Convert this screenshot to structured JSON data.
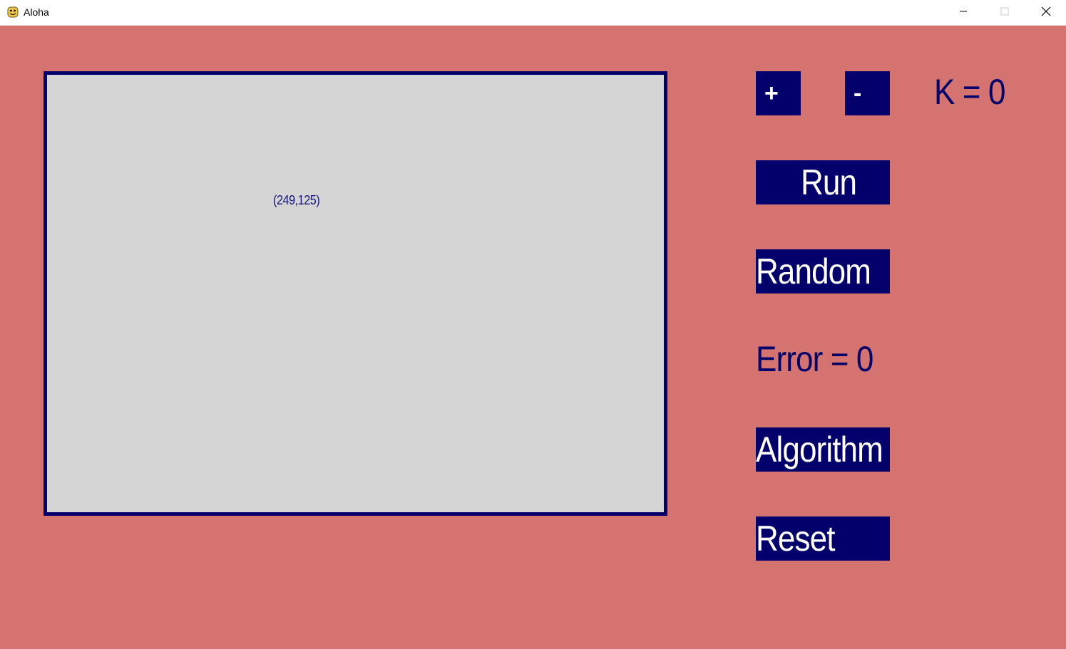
{
  "window": {
    "title": "Aloha",
    "app_icon": "python-icon",
    "controls": [
      "minimize-icon",
      "maximize-icon",
      "close-icon"
    ]
  },
  "canvas": {
    "coordinate_readout": "(249,125)"
  },
  "controls": {
    "plus_label": "+",
    "minus_label": "-",
    "k_text": "K = 0",
    "run_label": "Run",
    "random_label": "Random",
    "error_text": "Error = 0",
    "algorithm_label": "Algorithm",
    "reset_label": "Reset"
  },
  "colors": {
    "background": "#d57371",
    "accent": "#03006c",
    "canvas": "#d5d5d5",
    "button_text": "#ffffff"
  }
}
